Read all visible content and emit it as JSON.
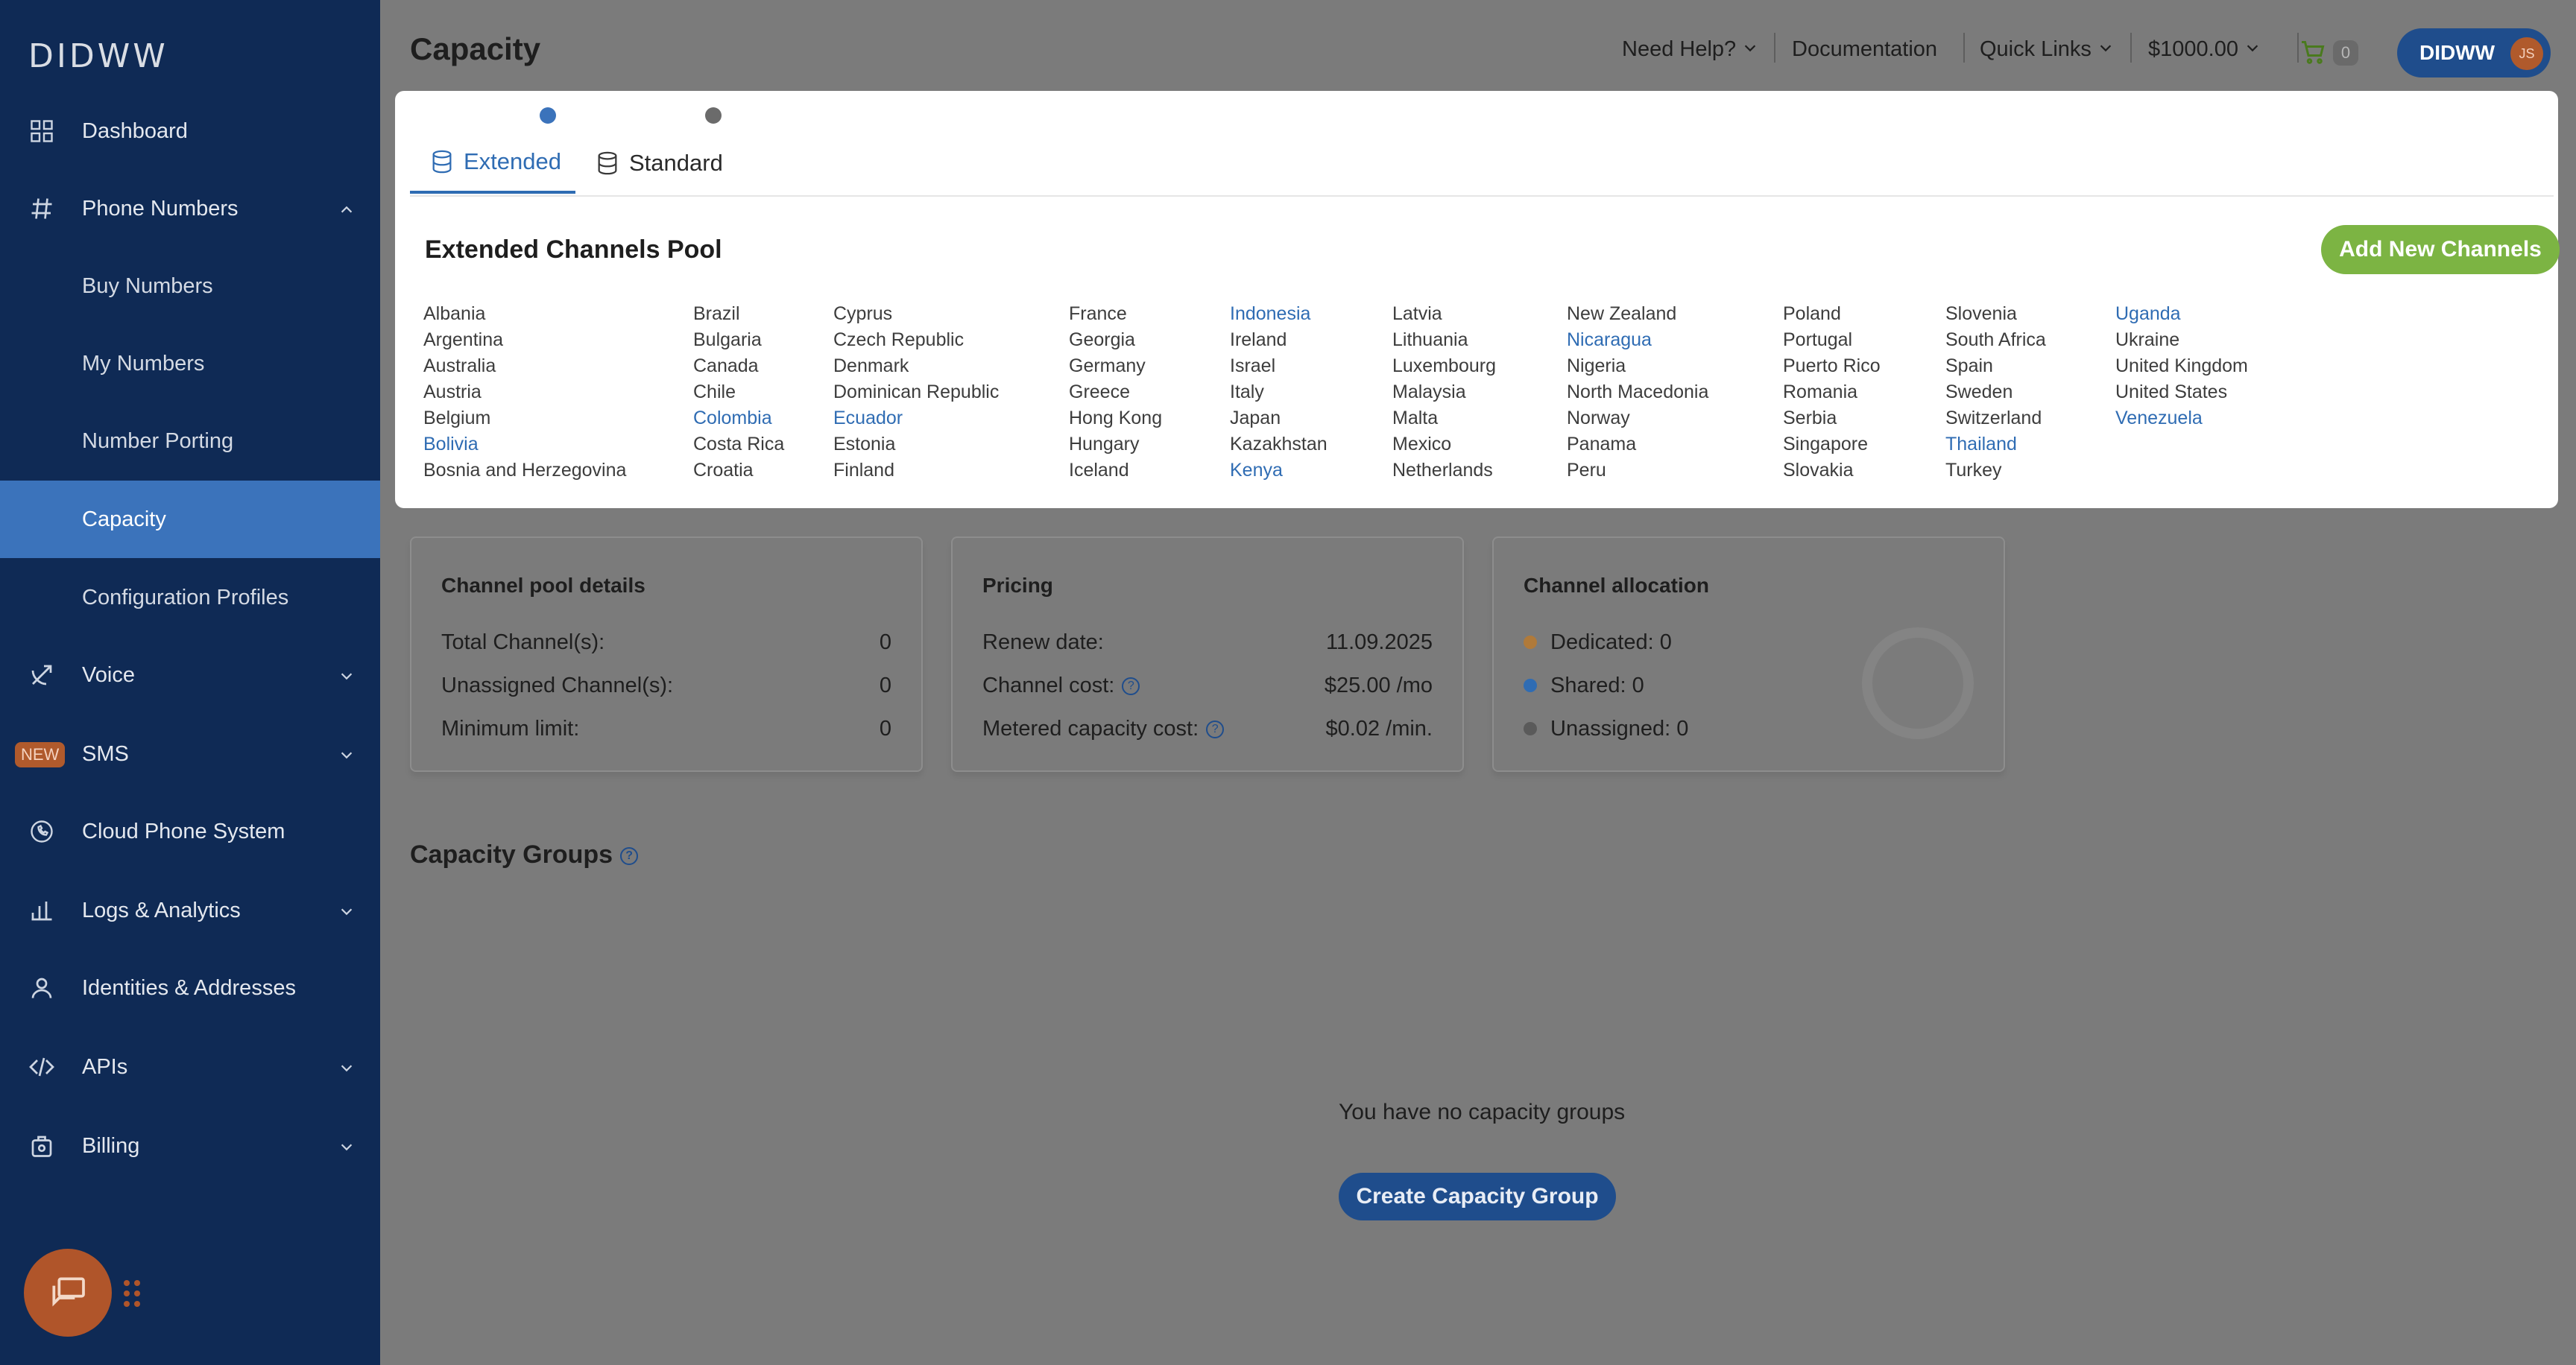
{
  "brand": {
    "logo_text": "DIDWW",
    "accent": "#2f6cb3",
    "sidebar_bg": "#0f2a55",
    "green": "#7cb443"
  },
  "sidebar": {
    "items": [
      {
        "label": "Dashboard",
        "icon": "dashboard-grid-icon"
      },
      {
        "label": "Phone Numbers",
        "icon": "hash-icon",
        "expanded": true
      },
      {
        "label": "Buy Numbers"
      },
      {
        "label": "My Numbers"
      },
      {
        "label": "Number Porting"
      },
      {
        "label": "Capacity",
        "active": true
      },
      {
        "label": "Configuration Profiles"
      },
      {
        "label": "Voice",
        "icon": "voice-transfer-icon"
      },
      {
        "label": "SMS",
        "badge": "NEW"
      },
      {
        "label": "Cloud Phone System",
        "icon": "phone-icon"
      },
      {
        "label": "Logs & Analytics",
        "icon": "bar-chart-icon"
      },
      {
        "label": "Identities & Addresses",
        "icon": "user-icon"
      },
      {
        "label": "APIs",
        "icon": "code-icon"
      },
      {
        "label": "Billing",
        "icon": "billing-bag-icon"
      }
    ]
  },
  "header": {
    "title": "Capacity",
    "need_help": "Need Help?",
    "documentation": "Documentation",
    "quick_links": "Quick Links",
    "balance": "$1000.00",
    "cart_count": "0",
    "account_label": "DIDWW",
    "avatar_initials": "JS"
  },
  "tabs": [
    {
      "label": "Extended",
      "active": true
    },
    {
      "label": "Standard",
      "active": false
    }
  ],
  "pool": {
    "title": "Extended Channels Pool",
    "add_button": "Add New Channels",
    "columns": [
      [
        {
          "t": "Albania"
        },
        {
          "t": "Argentina"
        },
        {
          "t": "Australia"
        },
        {
          "t": "Austria"
        },
        {
          "t": "Belgium"
        },
        {
          "t": "Bolivia",
          "link": true
        },
        {
          "t": "Bosnia and Herzegovina"
        }
      ],
      [
        {
          "t": "Brazil"
        },
        {
          "t": "Bulgaria"
        },
        {
          "t": "Canada"
        },
        {
          "t": "Chile"
        },
        {
          "t": "Colombia",
          "link": true
        },
        {
          "t": "Costa Rica"
        },
        {
          "t": "Croatia"
        }
      ],
      [
        {
          "t": "Cyprus"
        },
        {
          "t": "Czech Republic"
        },
        {
          "t": "Denmark"
        },
        {
          "t": "Dominican Republic"
        },
        {
          "t": "Ecuador",
          "link": true
        },
        {
          "t": "Estonia"
        },
        {
          "t": "Finland"
        }
      ],
      [
        {
          "t": "France"
        },
        {
          "t": "Georgia"
        },
        {
          "t": "Germany"
        },
        {
          "t": "Greece"
        },
        {
          "t": "Hong Kong"
        },
        {
          "t": "Hungary"
        },
        {
          "t": "Iceland"
        }
      ],
      [
        {
          "t": "Indonesia",
          "link": true
        },
        {
          "t": "Ireland"
        },
        {
          "t": "Israel"
        },
        {
          "t": "Italy"
        },
        {
          "t": "Japan"
        },
        {
          "t": "Kazakhstan"
        },
        {
          "t": "Kenya",
          "link": true
        }
      ],
      [
        {
          "t": "Latvia"
        },
        {
          "t": "Lithuania"
        },
        {
          "t": "Luxembourg"
        },
        {
          "t": "Malaysia"
        },
        {
          "t": "Malta"
        },
        {
          "t": "Mexico"
        },
        {
          "t": "Netherlands"
        }
      ],
      [
        {
          "t": "New Zealand"
        },
        {
          "t": "Nicaragua",
          "link": true
        },
        {
          "t": "Nigeria"
        },
        {
          "t": "North Macedonia"
        },
        {
          "t": "Norway"
        },
        {
          "t": "Panama"
        },
        {
          "t": "Peru"
        }
      ],
      [
        {
          "t": "Poland"
        },
        {
          "t": "Portugal"
        },
        {
          "t": "Puerto Rico"
        },
        {
          "t": "Romania"
        },
        {
          "t": "Serbia"
        },
        {
          "t": "Singapore"
        },
        {
          "t": "Slovakia"
        }
      ],
      [
        {
          "t": "Slovenia"
        },
        {
          "t": "South Africa"
        },
        {
          "t": "Spain"
        },
        {
          "t": "Sweden"
        },
        {
          "t": "Switzerland"
        },
        {
          "t": "Thailand",
          "link": true
        },
        {
          "t": "Turkey"
        }
      ],
      [
        {
          "t": "Uganda",
          "link": true
        },
        {
          "t": "Ukraine"
        },
        {
          "t": "United Kingdom"
        },
        {
          "t": "United States"
        },
        {
          "t": "Venezuela",
          "link": true
        }
      ]
    ]
  },
  "details": {
    "title": "Channel pool details",
    "rows": [
      {
        "label": "Total Channel(s):",
        "value": "0"
      },
      {
        "label": "Unassigned Channel(s):",
        "value": "0"
      },
      {
        "label": "Minimum limit:",
        "value": "0"
      }
    ]
  },
  "pricing": {
    "title": "Pricing",
    "rows": [
      {
        "label": "Renew date:",
        "value": "11.09.2025"
      },
      {
        "label": "Channel cost:",
        "value": "$25.00 /mo"
      },
      {
        "label": "Metered capacity cost:",
        "value": "$0.02 /min."
      }
    ]
  },
  "allocation": {
    "title": "Channel allocation",
    "rows": [
      {
        "label": "Dedicated: 0",
        "color": "#b07a3a"
      },
      {
        "label": "Shared: 0",
        "color": "#2f6cb3"
      },
      {
        "label": "Unassigned: 0",
        "color": "#5a5a5a"
      }
    ]
  },
  "groups": {
    "title": "Capacity Groups",
    "empty": "You have no capacity groups",
    "create_button": "Create Capacity Group"
  }
}
